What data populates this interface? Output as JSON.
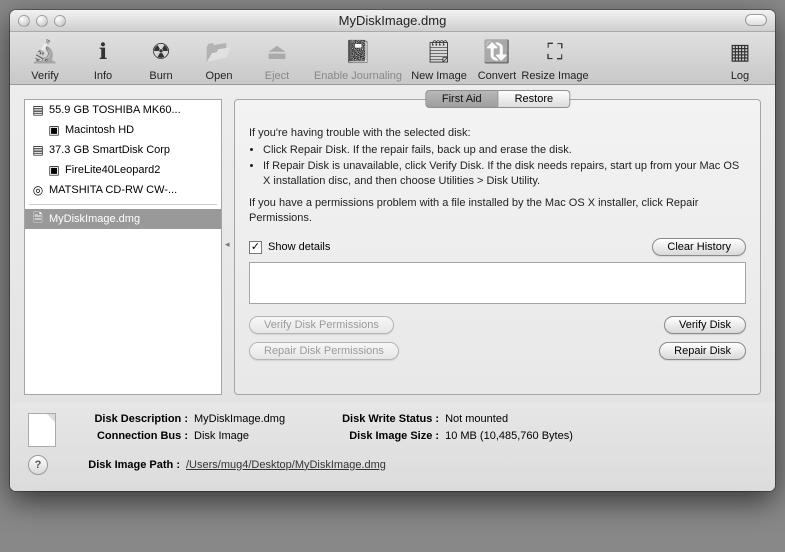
{
  "window": {
    "title": "MyDiskImage.dmg"
  },
  "toolbar": [
    {
      "label": "Verify",
      "glyph": "🔬",
      "name": "verify-tool",
      "enabled": true
    },
    {
      "label": "Info",
      "glyph": "ℹ︎",
      "name": "info-tool",
      "enabled": true
    },
    {
      "label": "Burn",
      "glyph": "☢︎",
      "name": "burn-tool",
      "enabled": true
    },
    {
      "label": "Open",
      "glyph": "📂",
      "name": "open-tool",
      "enabled": true
    },
    {
      "label": "Eject",
      "glyph": "⏏︎",
      "name": "eject-tool",
      "enabled": false
    },
    {
      "label": "Enable Journaling",
      "glyph": "📓",
      "name": "enable-journaling-tool",
      "enabled": false,
      "wide": true
    },
    {
      "label": "New Image",
      "glyph": "🗒",
      "name": "new-image-tool",
      "enabled": true
    },
    {
      "label": "Convert",
      "glyph": "🔃",
      "name": "convert-tool",
      "enabled": true
    },
    {
      "label": "Resize Image",
      "glyph": "⛶",
      "name": "resize-image-tool",
      "enabled": true
    }
  ],
  "toolbar_right": {
    "label": "Log",
    "glyph": "▦",
    "name": "log-tool"
  },
  "sidebar": {
    "items": [
      {
        "label": "55.9 GB TOSHIBA MK60...",
        "indent": 0,
        "icon": "▤",
        "name": "disk-toshiba"
      },
      {
        "label": "Macintosh HD",
        "indent": 1,
        "icon": "▣",
        "name": "volume-macintosh-hd"
      },
      {
        "label": "37.3 GB SmartDisk Corp",
        "indent": 0,
        "icon": "▤",
        "name": "disk-smartdisk"
      },
      {
        "label": "FireLite40Leopard2",
        "indent": 1,
        "icon": "▣",
        "name": "volume-firelite"
      },
      {
        "label": "MATSHITA CD-RW CW-...",
        "indent": 0,
        "icon": "◎",
        "name": "disk-matshita"
      }
    ],
    "images": [
      {
        "label": "MyDiskImage.dmg",
        "icon": "🗎",
        "name": "image-mydiskimage",
        "selected": true
      }
    ]
  },
  "tabs": {
    "first_aid": "First Aid",
    "restore": "Restore"
  },
  "firstaid": {
    "intro": "If you're having trouble with the selected disk:",
    "bullet1": "Click Repair Disk. If the repair fails, back up and erase the disk.",
    "bullet2": "If Repair Disk is unavailable, click Verify Disk. If the disk needs repairs, start up from your Mac OS X installation disc, and then choose Utilities > Disk Utility.",
    "perm_note": "If you have a permissions problem with a file installed by the Mac OS X installer, click Repair Permissions.",
    "show_details": "Show details",
    "clear_history": "Clear History",
    "verify_perms": "Verify Disk Permissions",
    "verify_disk": "Verify Disk",
    "repair_perms": "Repair Disk Permissions",
    "repair_disk": "Repair Disk"
  },
  "info": {
    "desc_k": "Disk Description :",
    "desc_v": "MyDiskImage.dmg",
    "bus_k": "Connection Bus :",
    "bus_v": "Disk Image",
    "write_k": "Disk Write Status :",
    "write_v": "Not mounted",
    "size_k": "Disk Image Size :",
    "size_v": "10 MB (10,485,760 Bytes)",
    "path_k": "Disk Image Path :",
    "path_v": "/Users/mug4/Desktop/MyDiskImage.dmg"
  }
}
